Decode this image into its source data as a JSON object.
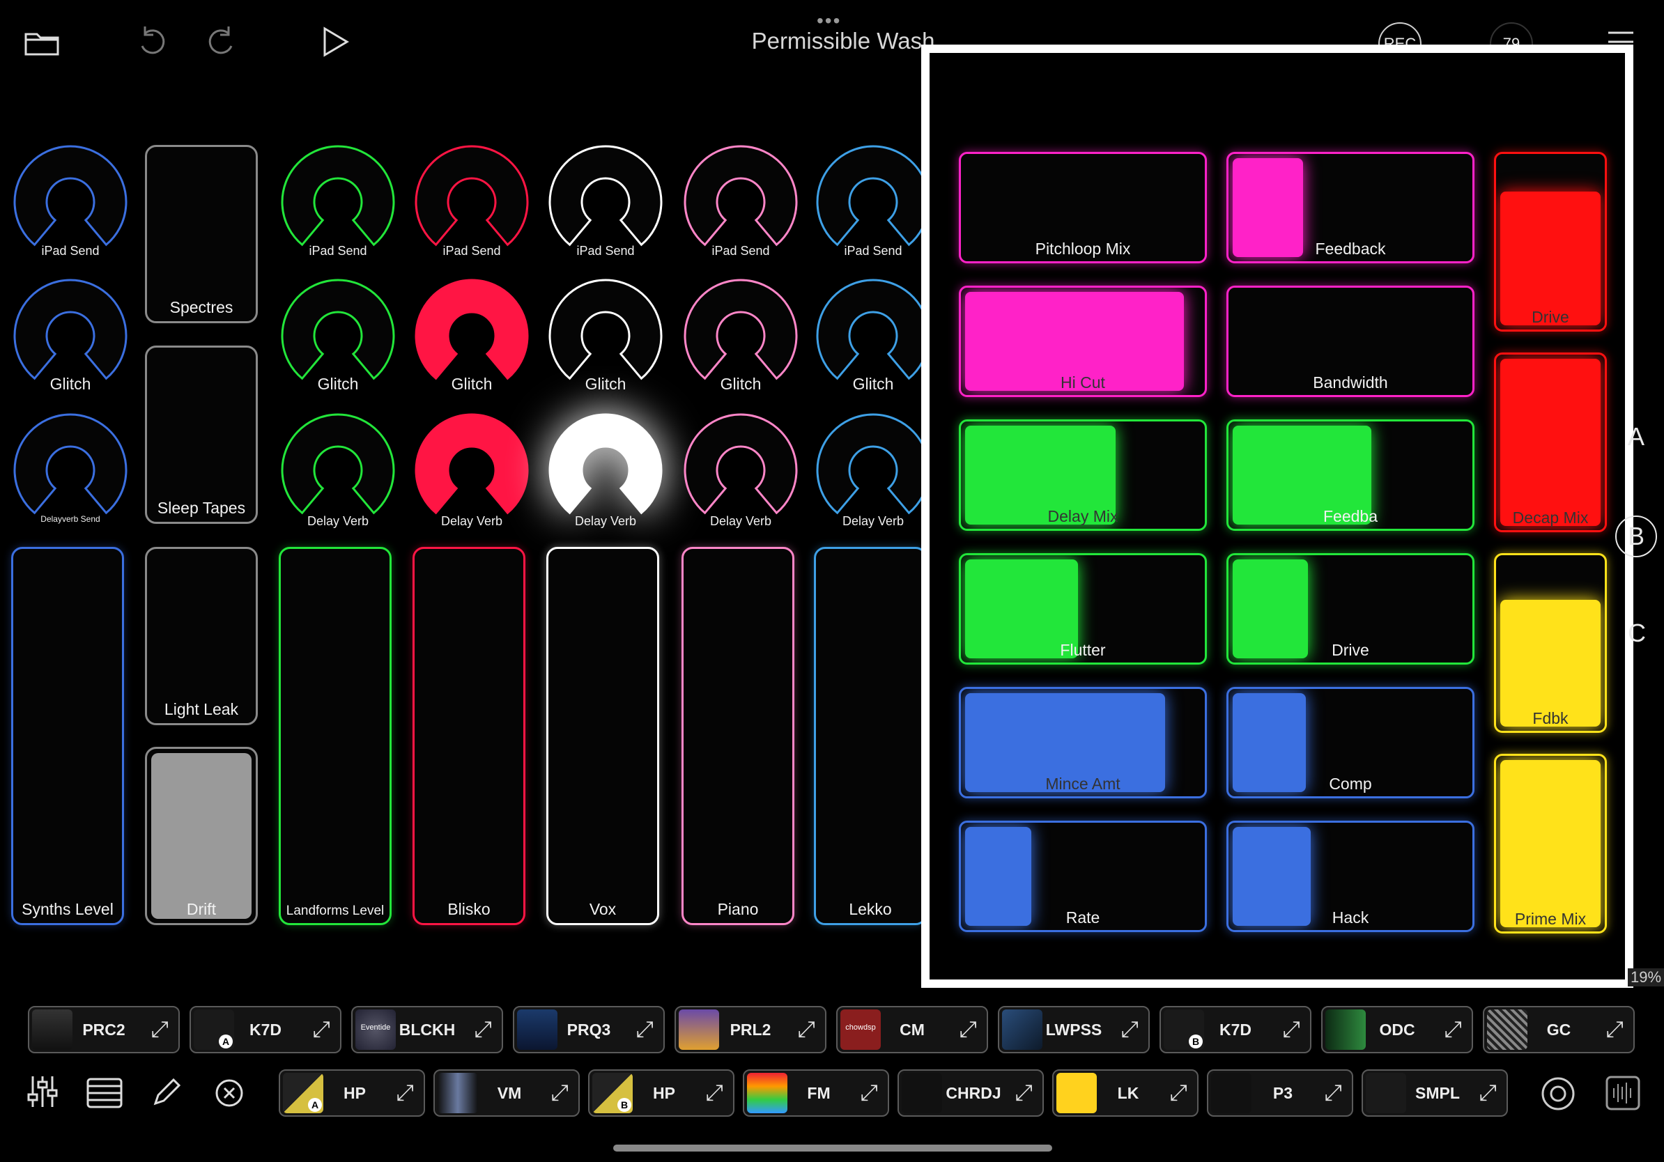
{
  "header": {
    "title": "Permissible Wash",
    "more_dots": "•••",
    "rec_label": "REC",
    "tempo": "79"
  },
  "colors": {
    "blue": "#3b6fe0",
    "green": "#22e63a",
    "red": "#ff1544",
    "white": "#ffffff",
    "pink": "#ff86c8",
    "lightblue": "#3ea0e6",
    "gray": "#9a9a9a",
    "magenta": "#ff22c8",
    "crimson": "#ff1010",
    "yellow": "#ffe21a"
  },
  "channels": [
    {
      "color": "blue",
      "knob1": "iPad Send",
      "knob2": "Glitch",
      "knob3": "Delayverb Send",
      "fader": "Synths Level",
      "level": 0
    },
    {
      "color": "green",
      "knob1": "iPad Send",
      "knob2": "Glitch",
      "knob3": "Delay Verb",
      "fader": "Landforms Level",
      "level": 0
    },
    {
      "color": "red",
      "knob1": "iPad Send",
      "knob2": "Glitch",
      "knob3": "Delay Verb",
      "fader": "Blisko",
      "level": 0
    },
    {
      "color": "white",
      "knob1": "iPad Send",
      "knob2": "Glitch",
      "knob3": "Delay Verb",
      "fader": "Vox",
      "level": 0
    },
    {
      "color": "pink",
      "knob1": "iPad Send",
      "knob2": "Glitch",
      "knob3": "Delay Verb",
      "fader": "Piano",
      "level": 0
    },
    {
      "color": "lightblue",
      "knob1": "iPad Send",
      "knob2": "Glitch",
      "knob3": "Delay Verb",
      "fader": "Lekko",
      "level": 0
    }
  ],
  "gray_column": {
    "top1": "Spectres",
    "top2": "Sleep Tapes",
    "mid": "Light Leak",
    "bottom": "Drift",
    "bottom_level": 1.0
  },
  "panel": {
    "pads": [
      {
        "label": "Pitchloop Mix",
        "color": "magenta",
        "level": 0
      },
      {
        "label": "Feedback",
        "color": "magenta",
        "level": 0.3
      },
      {
        "label": "Drive",
        "color": "crimson",
        "level": 0.8,
        "vertical": true
      },
      {
        "label": "Hi Cut",
        "color": "magenta",
        "level": 0.93
      },
      {
        "label": "Bandwidth",
        "color": "magenta",
        "level": 0
      },
      {
        "label": "Decap Mix",
        "color": "crimson",
        "level": 1.0,
        "vertical": true
      },
      {
        "label": "Delay Mix",
        "color": "green",
        "level": 0.64
      },
      {
        "label": "Feedba",
        "color": "green",
        "level": 0.59
      },
      {
        "label": "Fdbk",
        "color": "yellow",
        "level": 0.76,
        "vertical": true
      },
      {
        "label": "Flutter",
        "color": "green",
        "level": 0.48
      },
      {
        "label": "Drive",
        "color": "green",
        "level": 0.32
      },
      {
        "label": "Prime Mix",
        "color": "yellow",
        "level": 1.0,
        "vertical": true
      },
      {
        "label": "Mince Amt",
        "color": "blue",
        "level": 0.85
      },
      {
        "label": "Comp",
        "color": "blue",
        "level": 0.31
      },
      {
        "label": "Rate",
        "color": "blue",
        "level": 0.28
      },
      {
        "label": "Hack",
        "color": "blue",
        "level": 0.33
      }
    ],
    "side_letters": [
      "A",
      "B",
      "C"
    ],
    "percent_badge": "19%"
  },
  "plugins_row1": [
    {
      "label": "PRC2"
    },
    {
      "label": "K7D",
      "badge": "A"
    },
    {
      "label": "BLCKH",
      "thumb_text": "Eventide"
    },
    {
      "label": "PRQ3"
    },
    {
      "label": "PRL2"
    },
    {
      "label": "CM",
      "thumb_text": "chowdsp"
    },
    {
      "label": "LWPSS"
    },
    {
      "label": "K7D",
      "badge": "B"
    },
    {
      "label": "ODC"
    },
    {
      "label": "GC"
    }
  ],
  "plugins_row2": [
    {
      "label": "HP",
      "badge": "A"
    },
    {
      "label": "VM"
    },
    {
      "label": "HP",
      "badge": "B"
    },
    {
      "label": "FM"
    },
    {
      "label": "CHRDJ"
    },
    {
      "label": "LK"
    },
    {
      "label": "P3"
    },
    {
      "label": "SMPL"
    }
  ],
  "icons": {
    "folder": "folder-icon",
    "undo": "undo-icon",
    "redo": "redo-icon",
    "play": "play-icon",
    "menu": "menu-icon",
    "mixer": "mixer-icon",
    "list": "list-icon",
    "pencil": "pencil-icon",
    "close": "close-circle-icon",
    "settings": "settings-icon",
    "waveform": "waveform-icon",
    "expand": "expand-icon"
  }
}
